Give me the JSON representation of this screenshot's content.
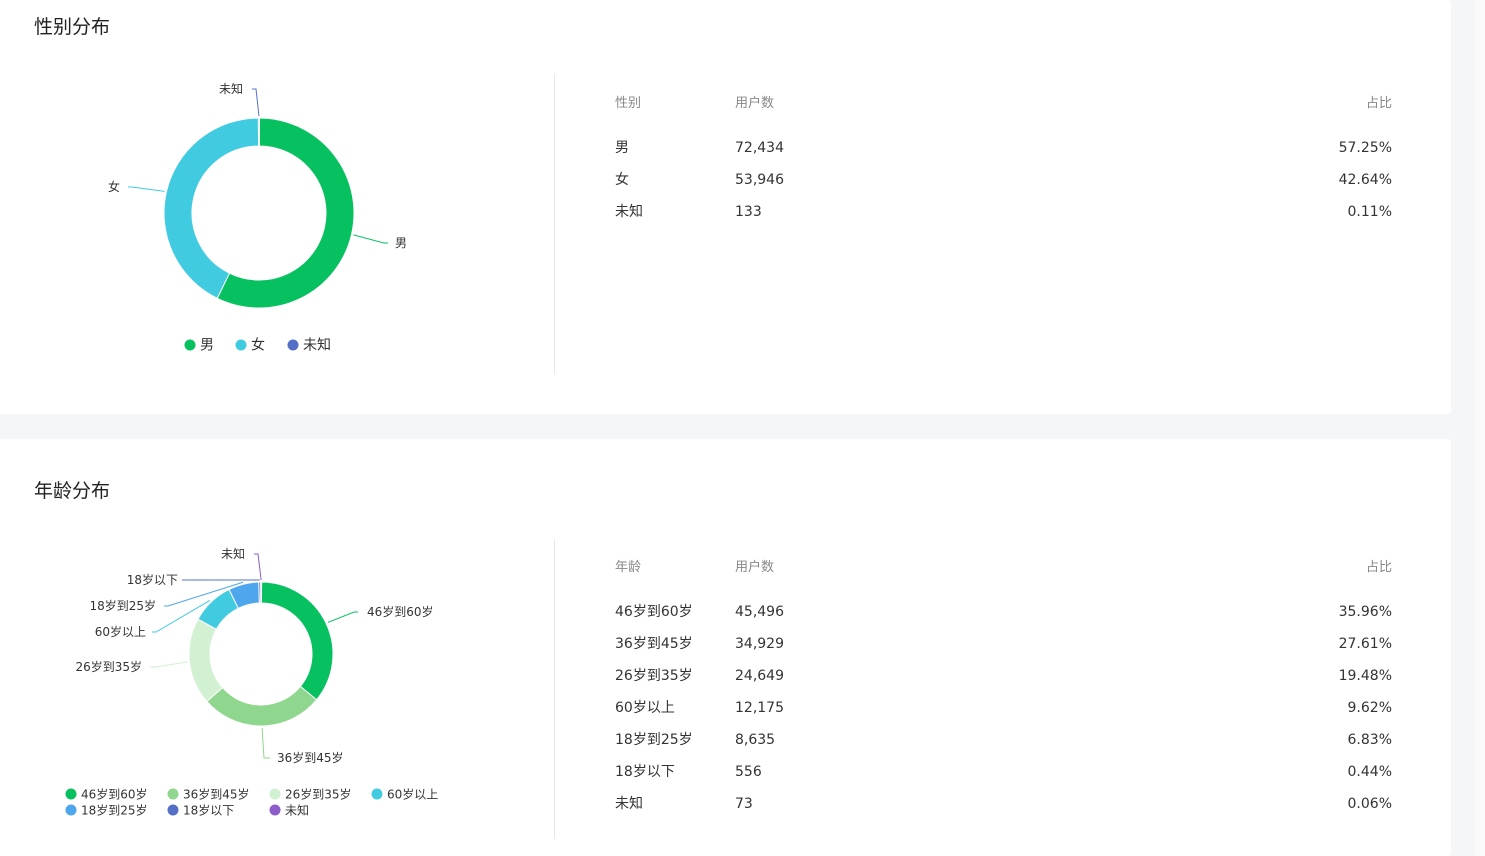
{
  "gender": {
    "title": "性别分布",
    "table": {
      "headers": [
        "性别",
        "用户数",
        "占比"
      ],
      "rows": [
        [
          "男",
          "72,434",
          "57.25%"
        ],
        [
          "女",
          "53,946",
          "42.64%"
        ],
        [
          "未知",
          "133",
          "0.11%"
        ]
      ]
    }
  },
  "age": {
    "title": "年龄分布",
    "table": {
      "headers": [
        "年龄",
        "用户数",
        "占比"
      ],
      "rows": [
        [
          "46岁到60岁",
          "45,496",
          "35.96%"
        ],
        [
          "36岁到45岁",
          "34,929",
          "27.61%"
        ],
        [
          "26岁到35岁",
          "24,649",
          "19.48%"
        ],
        [
          "60岁以上",
          "12,175",
          "9.62%"
        ],
        [
          "18岁到25岁",
          "8,635",
          "6.83%"
        ],
        [
          "18岁以下",
          "556",
          "0.44%"
        ],
        [
          "未知",
          "73",
          "0.06%"
        ]
      ]
    }
  },
  "chart_data": [
    {
      "type": "pie",
      "title": "性别分布",
      "categories": [
        "男",
        "女",
        "未知"
      ],
      "values": [
        72434,
        53946,
        133
      ],
      "colors": [
        "#07c160",
        "#40cbe0",
        "#5470c6"
      ],
      "legend": [
        "男",
        "女",
        "未知"
      ],
      "legend_position": "bottom"
    },
    {
      "type": "pie",
      "title": "年龄分布",
      "categories": [
        "46岁到60岁",
        "36岁到45岁",
        "26岁到35岁",
        "60岁以上",
        "18岁到25岁",
        "18岁以下",
        "未知"
      ],
      "values": [
        45496,
        34929,
        24649,
        12175,
        8635,
        556,
        73
      ],
      "colors": [
        "#07c160",
        "#8fd68f",
        "#d2f0d2",
        "#40cbe0",
        "#4ea6ec",
        "#5470c6",
        "#8c5cc8"
      ],
      "legend": [
        "46岁到60岁",
        "36岁到45岁",
        "26岁到35岁",
        "60岁以上",
        "18岁到25岁",
        "18岁以下",
        "未知"
      ],
      "legend_position": "bottom"
    }
  ]
}
